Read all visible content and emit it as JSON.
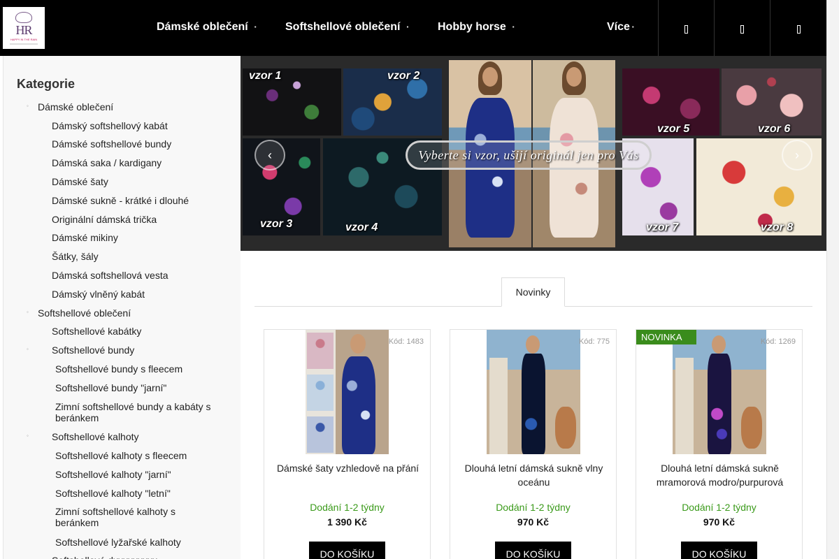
{
  "header": {
    "logo_icon": "happy-in-the-rain-logo",
    "logo_mark": "HR",
    "logo_text": "HAPPY IN THE RAIN",
    "nav": [
      {
        "label": "Dámské oblečení"
      },
      {
        "label": "Softshellové oblečení"
      },
      {
        "label": "Hobby horse"
      },
      {
        "label": "Více"
      }
    ],
    "icons": [
      "search-icon",
      "user-icon",
      "cart-icon"
    ]
  },
  "sidebar": {
    "title": "Kategorie",
    "items": [
      "Dámské oblečení",
      "Dámský softshellový kabát",
      "Dámské softshellové bundy",
      "Dámská saka / kardigany",
      "Dámské šaty",
      "Dámské sukně - krátké i dlouhé",
      "Originální dámská trička",
      "Dámské mikiny",
      "Šátky, šály",
      "Dámská softshellová vesta",
      "Dámský vlněný kabát",
      "Softshellové oblečení",
      "Softshellové kabátky",
      "Softshellové bundy",
      "Softshellové bundy s fleecem",
      "Softshellové bundy \"jarní\"",
      "Zimní softshellové bundy a kabáty s beránkem",
      "Softshellové kalhoty",
      "Softshellové kalhoty s fleecem",
      "Softshellové kalhoty \"jarní\"",
      "Softshellové kalhoty \"letní\"",
      "Zimní softshellové kalhoty s beránkem",
      "Softshellové lyžařské kalhoty",
      "Softshellové dxxxxxxxxx"
    ]
  },
  "banner": {
    "patterns": [
      "vzor 1",
      "vzor 2",
      "vzor 3",
      "vzor 4",
      "vzor 5",
      "vzor 6",
      "vzor 7",
      "vzor 8"
    ],
    "slogan": "Vyberte si vzor, ušijí originál jen pro Vás",
    "prev_icon": "chevron-left-icon",
    "next_icon": "chevron-right-icon"
  },
  "tabs": [
    {
      "label": "Novinky"
    }
  ],
  "products": [
    {
      "code": "Kód: 1483",
      "badge": "",
      "name": "Dámské šaty vzhledově na přání",
      "availability": "Dodání 1-2 týdny",
      "price": "1 390 Kč",
      "button": "DO KOŠÍKU"
    },
    {
      "code": "Kód: 775",
      "badge": "",
      "name": "Dlouhá letní dámská sukně vlny oceánu",
      "availability": "Dodání 1-2 týdny",
      "price": "970 Kč",
      "button": "DO KOŠÍKU"
    },
    {
      "code": "Kód: 1269",
      "badge": "NOVINKA",
      "name": "Dlouhá letní dámská sukně mramorová modro/purpurová",
      "availability": "Dodání 1-2 týdny",
      "price": "970 Kč",
      "button": "DO KOŠÍKU"
    }
  ],
  "colors": {
    "header_bg": "#000000",
    "sidebar_bg": "#f8f8f8",
    "availability": "#3a9a1a",
    "badge": "#3a8c1c",
    "button_bg": "#000000"
  }
}
